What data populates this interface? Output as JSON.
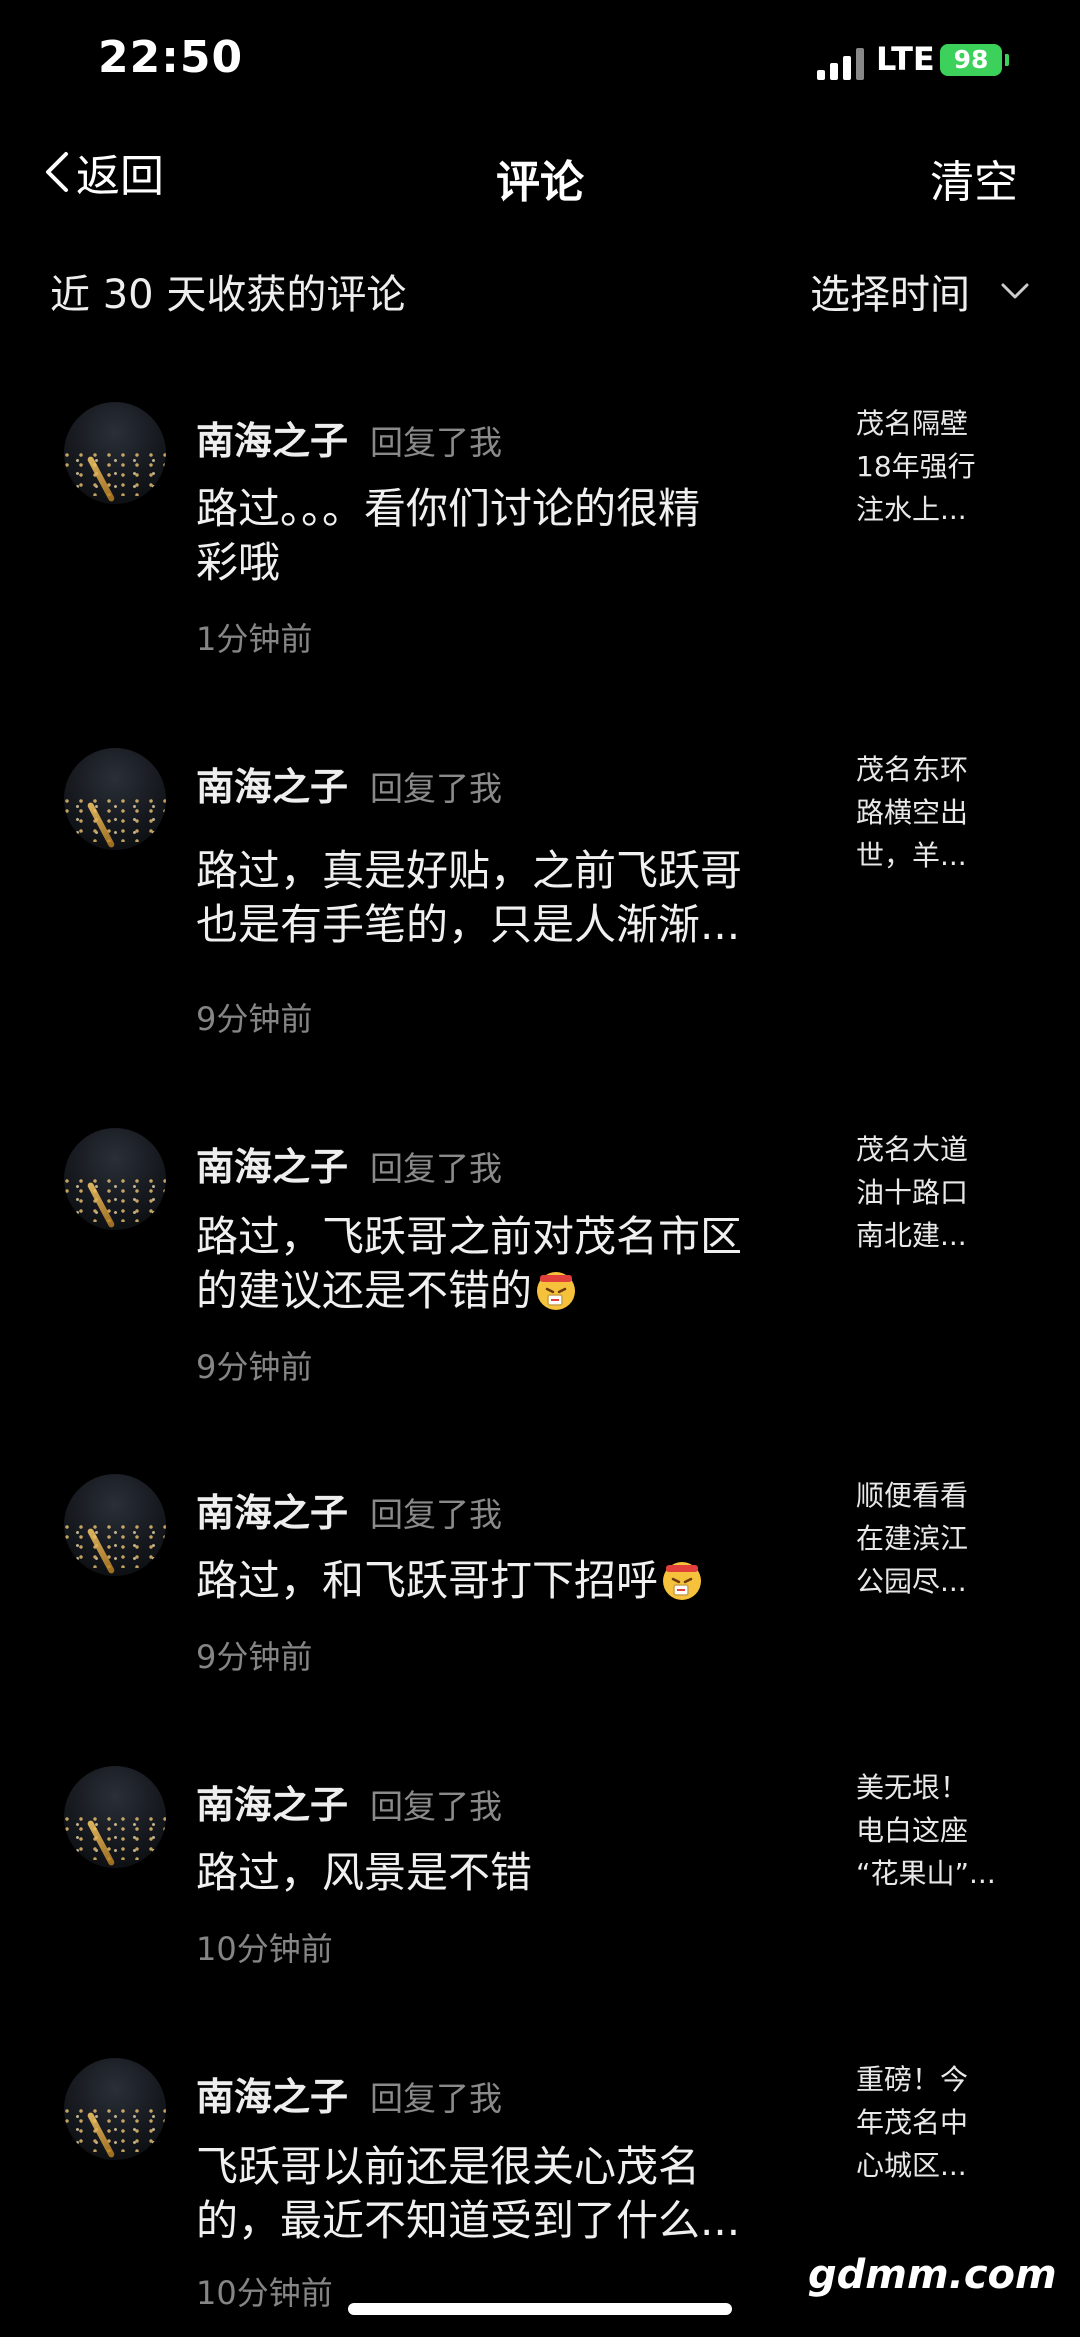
{
  "status_bar": {
    "time": "22:50",
    "network": "LTE",
    "battery": "98"
  },
  "nav": {
    "back_label": "返回",
    "title": "评论",
    "clear_label": "清空"
  },
  "filter": {
    "period_label": "近 30 天收获的评论",
    "time_picker_label": "选择时间"
  },
  "comments": [
    {
      "user": "南海之子",
      "action": "回复了我",
      "text_lines": [
        "路过。。。看你们讨论的很精",
        "彩哦"
      ],
      "time": "1分钟前",
      "video_lines": [
        "茂名隔壁",
        "18年强行",
        "注水上..."
      ]
    },
    {
      "user": "南海之子",
      "action": "回复了我",
      "text_lines": [
        "路过，真是好贴，之前飞跃哥",
        "也是有手笔的，只是人渐渐..."
      ],
      "time": "9分钟前",
      "video_lines": [
        "茂名东环",
        "路横空出",
        "世，羊..."
      ]
    },
    {
      "user": "南海之子",
      "action": "回复了我",
      "text_lines": [
        "路过，飞跃哥之前对茂名市区",
        "的建议还是不错的"
      ],
      "time": "9分钟前",
      "video_lines": [
        "茂名大道",
        "油十路口",
        "南北建..."
      ]
    },
    {
      "user": "南海之子",
      "action": "回复了我",
      "text_lines": [
        "路过，和飞跃哥打下招呼"
      ],
      "time": "9分钟前",
      "video_lines": [
        "顺便看看",
        "在建滨江",
        "公园尽..."
      ]
    },
    {
      "user": "南海之子",
      "action": "回复了我",
      "text_lines": [
        "路过，风景是不错"
      ],
      "time": "10分钟前",
      "video_lines": [
        "美无垠！",
        "电白这座",
        "“花果山”..."
      ]
    },
    {
      "user": "南海之子",
      "action": "回复了我",
      "text_lines": [
        "飞跃哥以前还是很关心茂名",
        "的，最近不知道受到了什么..."
      ],
      "time": "10分钟前",
      "video_lines": [
        "重磅！今",
        "年茂名中",
        "心城区..."
      ]
    }
  ],
  "watermark": "gdmm.com",
  "colors": {
    "background": "#000000",
    "battery": "#3bd15a",
    "secondary_text": "#8a8a8a"
  },
  "icons": [
    "back-chevron-icon",
    "chevron-down-icon",
    "signal-icon",
    "emoji-icon"
  ]
}
